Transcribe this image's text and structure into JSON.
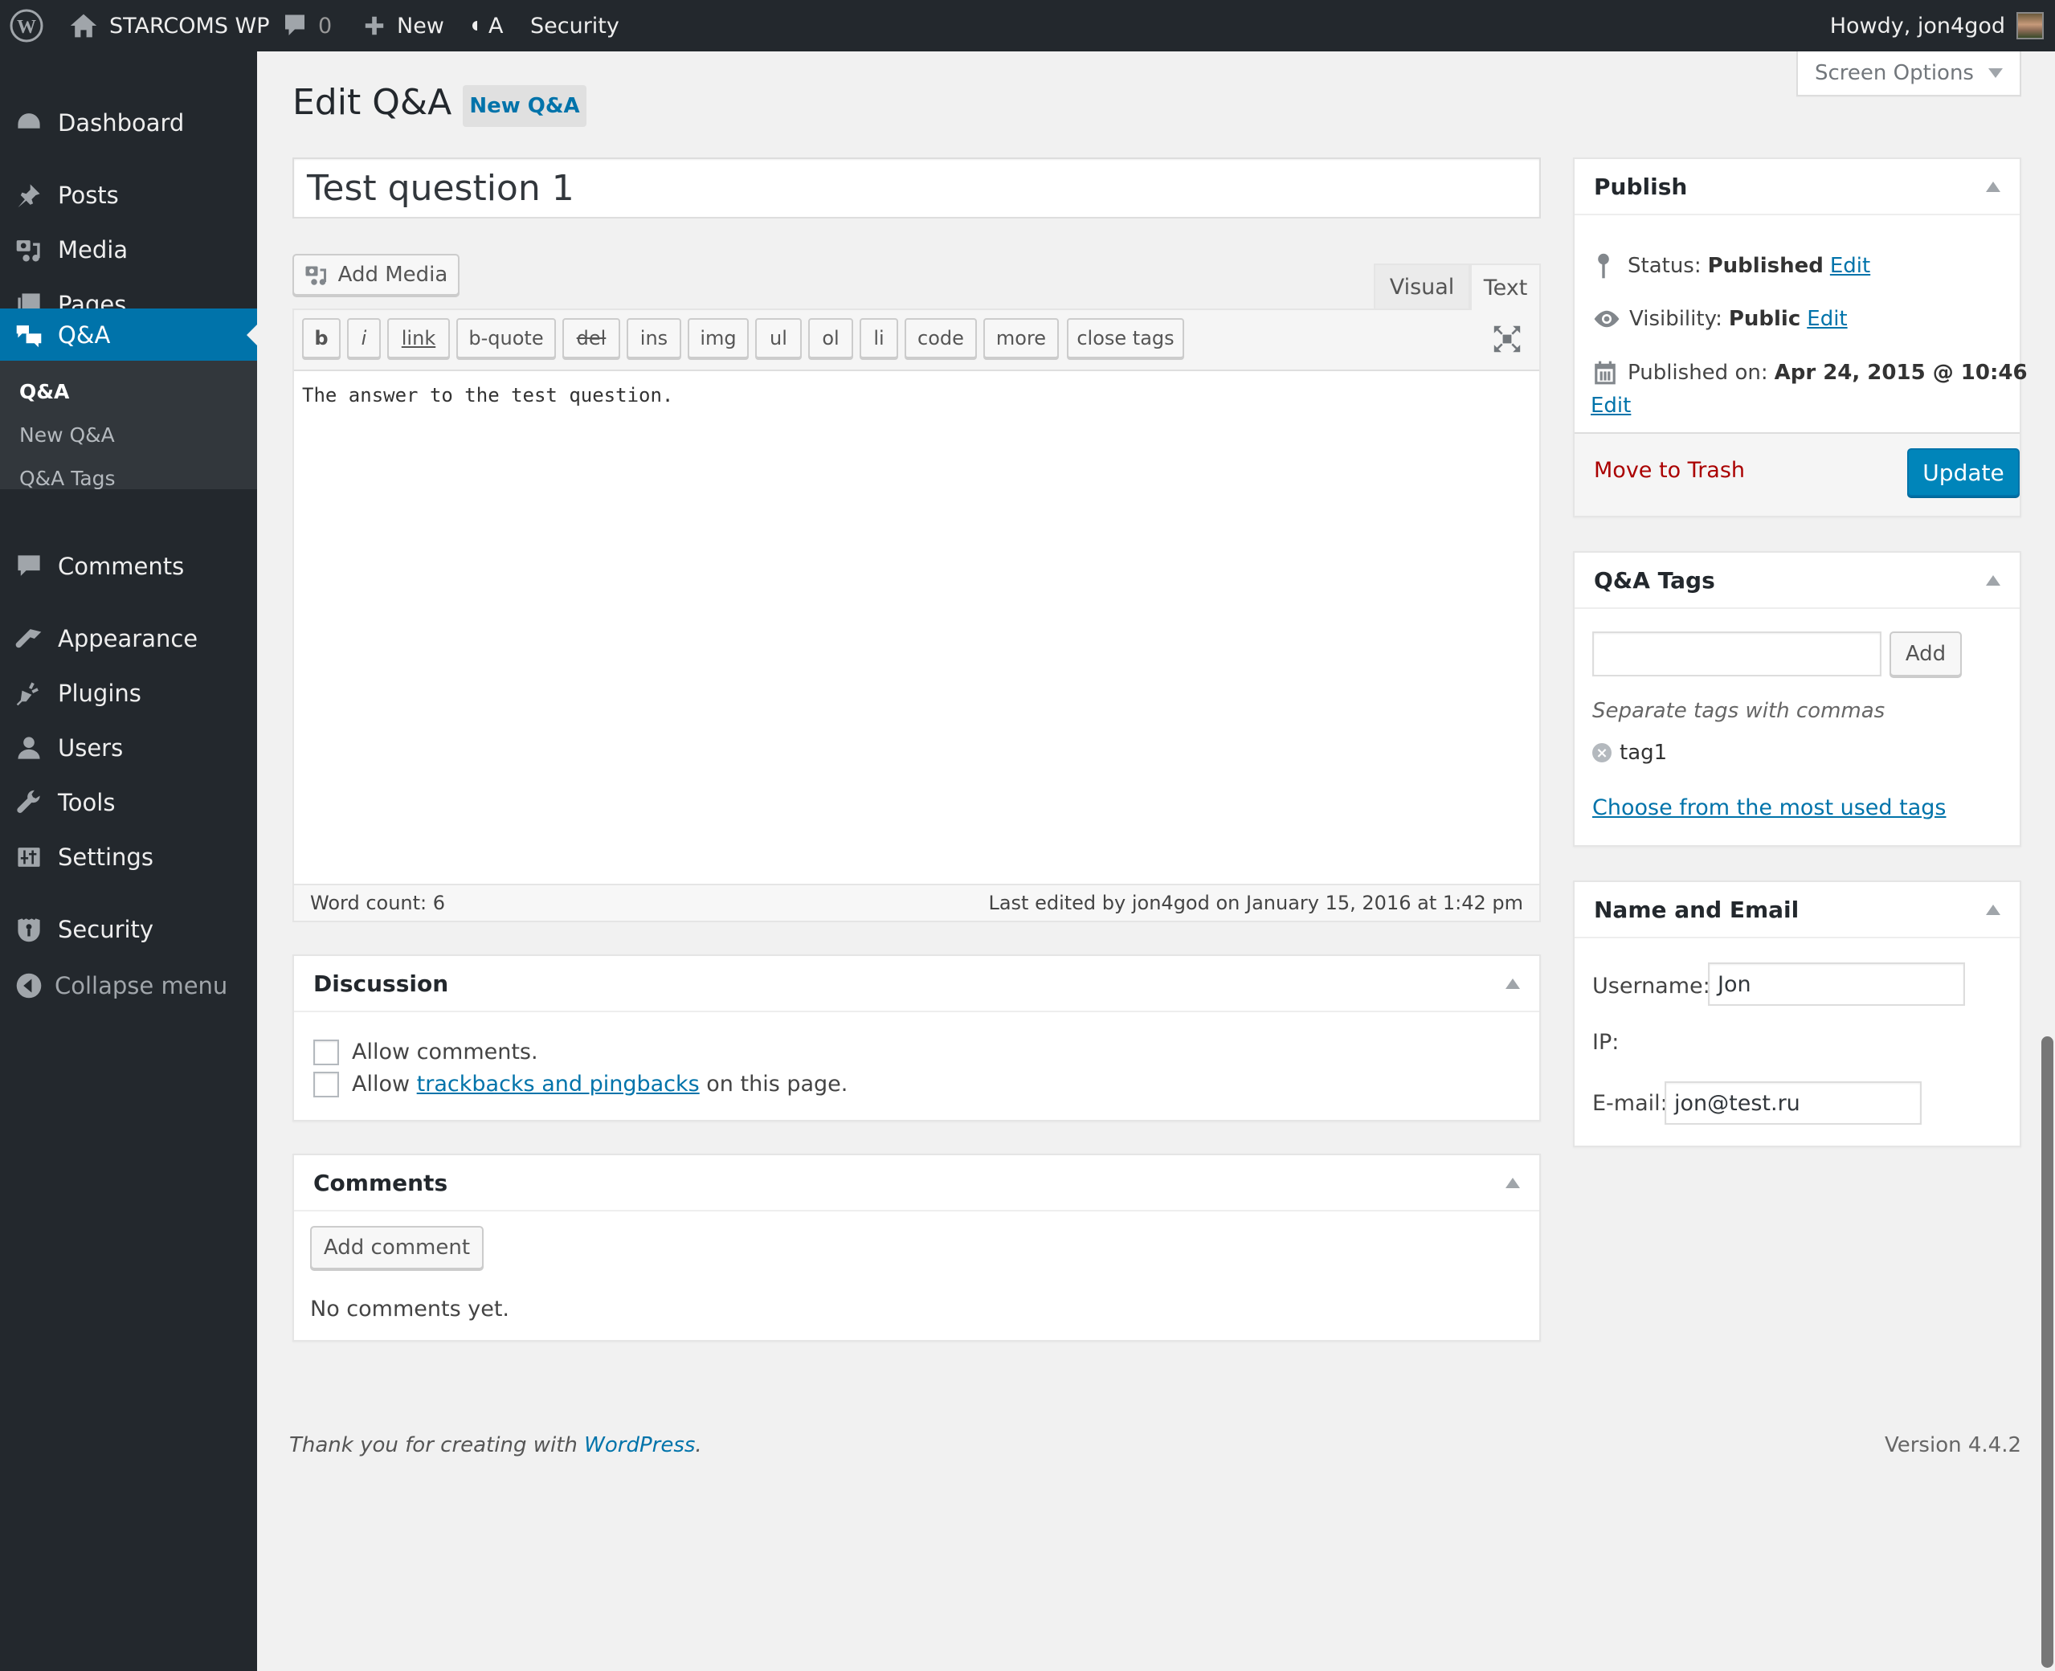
{
  "admin_bar": {
    "site_name": "STARCOMS WP",
    "comments_count": "0",
    "new_label": "New",
    "a_label": "A",
    "security_label": "Security",
    "greeting": "Howdy, jon4god"
  },
  "sidebar": {
    "items": [
      {
        "label": "Dashboard",
        "icon": "dashboard-icon"
      },
      {
        "label": "Posts",
        "icon": "pin-icon"
      },
      {
        "label": "Media",
        "icon": "media-icon"
      },
      {
        "label": "Pages",
        "icon": "pages-icon"
      },
      {
        "label": "Q&A",
        "icon": "speech-bubbles-icon",
        "current": true
      },
      {
        "label": "Comments",
        "icon": "comment-icon"
      },
      {
        "label": "Appearance",
        "icon": "paintbrush-icon"
      },
      {
        "label": "Plugins",
        "icon": "plug-icon"
      },
      {
        "label": "Users",
        "icon": "user-icon"
      },
      {
        "label": "Tools",
        "icon": "wrench-icon"
      },
      {
        "label": "Settings",
        "icon": "settings-icon"
      },
      {
        "label": "Security",
        "icon": "shield-icon"
      }
    ],
    "submenu": [
      {
        "label": "Q&A",
        "current": true
      },
      {
        "label": "New Q&A"
      },
      {
        "label": "Q&A Tags"
      }
    ],
    "collapse_label": "Collapse menu"
  },
  "screen_options": "Screen Options",
  "page": {
    "title": "Edit Q&A",
    "add_new_label": "New Q&A"
  },
  "editor": {
    "post_title": "Test question 1",
    "add_media_label": "Add Media",
    "tabs": {
      "visual": "Visual",
      "text": "Text",
      "active": "Text"
    },
    "quicktags": [
      "b",
      "i",
      "link",
      "b-quote",
      "del",
      "ins",
      "img",
      "ul",
      "ol",
      "li",
      "code",
      "more",
      "close tags"
    ],
    "content": "The answer to the test question.",
    "word_count": "Word count: 6",
    "last_edited": "Last edited by jon4god on January 15, 2016 at 1:42 pm"
  },
  "discussion": {
    "title": "Discussion",
    "allow_comments": "Allow comments.",
    "allow_pings_prefix": "Allow ",
    "allow_pings_link": "trackbacks and pingbacks",
    "allow_pings_suffix": " on this page.",
    "allow_comments_checked": false,
    "allow_pings_checked": false
  },
  "comments_box": {
    "title": "Comments",
    "add_comment_label": "Add comment",
    "empty_text": "No comments yet."
  },
  "publish": {
    "title": "Publish",
    "status_label": "Status:",
    "status_value": "Published",
    "visibility_label": "Visibility:",
    "visibility_value": "Public",
    "published_on_label": "Published on:",
    "published_on_value": "Apr 24, 2015 @ 10:46",
    "edit_label": "Edit",
    "trash_label": "Move to Trash",
    "update_label": "Update"
  },
  "tags_box": {
    "title": "Q&A Tags",
    "input_value": "",
    "add_label": "Add",
    "hint": "Separate tags with commas",
    "tags": [
      "tag1"
    ],
    "most_used_link": "Choose from the most used tags"
  },
  "name_email": {
    "title": "Name and Email",
    "username_label": "Username:",
    "username_value": "Jon",
    "ip_label": "IP:",
    "email_label": "E-mail:",
    "email_value": "jon@test.ru"
  },
  "footer": {
    "thanks_prefix": "Thank you for creating with ",
    "thanks_link": "WordPress",
    "thanks_suffix": ".",
    "version": "Version 4.4.2"
  },
  "colors": {
    "accent": "#0073aa",
    "admin_bar": "#23282d",
    "trash": "#a00",
    "background": "#f1f1f1"
  }
}
